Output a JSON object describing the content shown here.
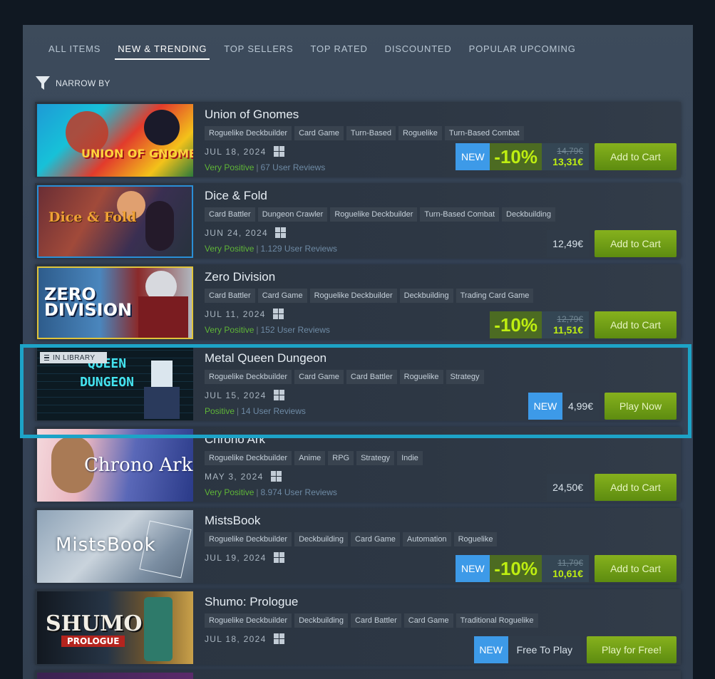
{
  "tabs": [
    {
      "label": "ALL ITEMS",
      "active": false
    },
    {
      "label": "NEW & TRENDING",
      "active": true
    },
    {
      "label": "TOP SELLERS",
      "active": false
    },
    {
      "label": "TOP RATED",
      "active": false
    },
    {
      "label": "DISCOUNTED",
      "active": false
    },
    {
      "label": "POPULAR UPCOMING",
      "active": false
    }
  ],
  "filter": {
    "label": "NARROW BY",
    "icon": "funnel-icon"
  },
  "colors": {
    "accent_green": "#beee11",
    "new_badge": "#3d9ae8",
    "positive": "#5fb537",
    "highlight_border": "#1da3c7"
  },
  "games": [
    {
      "title": "Union of Gnomes",
      "capsule_text": "UNION OF GNOMES",
      "tags": [
        "Roguelike Deckbuilder",
        "Card Game",
        "Turn-Based",
        "Roguelike",
        "Turn-Based Combat"
      ],
      "date": "JUL 18, 2024",
      "platform_icon": "windows-icon",
      "review": "Very Positive",
      "review_sep": "|",
      "review_count": "67 User Reviews",
      "new": "NEW",
      "discount": "-10%",
      "original_price": "14,79€",
      "final_price": "13,31€",
      "button": "Add to Cart"
    },
    {
      "title": "Dice & Fold",
      "capsule_text": "Dice & Fold",
      "tags": [
        "Card Battler",
        "Dungeon Crawler",
        "Roguelike Deckbuilder",
        "Turn-Based Combat",
        "Deckbuilding"
      ],
      "date": "JUN 24, 2024",
      "platform_icon": "windows-icon",
      "review": "Very Positive",
      "review_sep": "|",
      "review_count": "1.129 User Reviews",
      "price": "12,49€",
      "button": "Add to Cart"
    },
    {
      "title": "Zero Division",
      "capsule_text": "ZERO DIVISION",
      "tags": [
        "Card Battler",
        "Card Game",
        "Roguelike Deckbuilder",
        "Deckbuilding",
        "Trading Card Game"
      ],
      "date": "JUL 11, 2024",
      "platform_icon": "windows-icon",
      "review": "Very Positive",
      "review_sep": "|",
      "review_count": "152 User Reviews",
      "discount": "-10%",
      "original_price": "12,79€",
      "final_price": "11,51€",
      "button": "Add to Cart"
    },
    {
      "title": "Metal Queen Dungeon",
      "capsule_text": "QUEEN DUNGEON",
      "in_library": "IN LIBRARY",
      "tags": [
        "Roguelike Deckbuilder",
        "Card Game",
        "Card Battler",
        "Roguelike",
        "Strategy"
      ],
      "date": "JUL 15, 2024",
      "platform_icon": "windows-icon",
      "review": "Positive",
      "review_sep": "|",
      "review_count": "14 User Reviews",
      "new": "NEW",
      "price": "4,99€",
      "button": "Play Now"
    },
    {
      "title": "Chrono Ark",
      "capsule_text": "Chrono Ark",
      "tags": [
        "Roguelike Deckbuilder",
        "Anime",
        "RPG",
        "Strategy",
        "Indie"
      ],
      "date": "MAY 3, 2024",
      "platform_icon": "windows-icon",
      "review": "Very Positive",
      "review_sep": "|",
      "review_count": "8.974 User Reviews",
      "price": "24,50€",
      "button": "Add to Cart"
    },
    {
      "title": "MistsBook",
      "capsule_text": "MistsBook",
      "tags": [
        "Roguelike Deckbuilder",
        "Deckbuilding",
        "Card Game",
        "Automation",
        "Roguelike"
      ],
      "date": "JUL 19, 2024",
      "platform_icon": "windows-icon",
      "new": "NEW",
      "discount": "-10%",
      "original_price": "11,79€",
      "final_price": "10,61€",
      "button": "Add to Cart"
    },
    {
      "title": "Shumo: Prologue",
      "capsule_text": "SHUMO",
      "capsule_sub": "PROLOGUE",
      "tags": [
        "Roguelike Deckbuilder",
        "Deckbuilding",
        "Card Battler",
        "Card Game",
        "Traditional Roguelike"
      ],
      "date": "JUL 18, 2024",
      "platform_icon": "windows-icon",
      "new": "NEW",
      "price": "Free To Play",
      "button": "Play for Free!"
    }
  ]
}
